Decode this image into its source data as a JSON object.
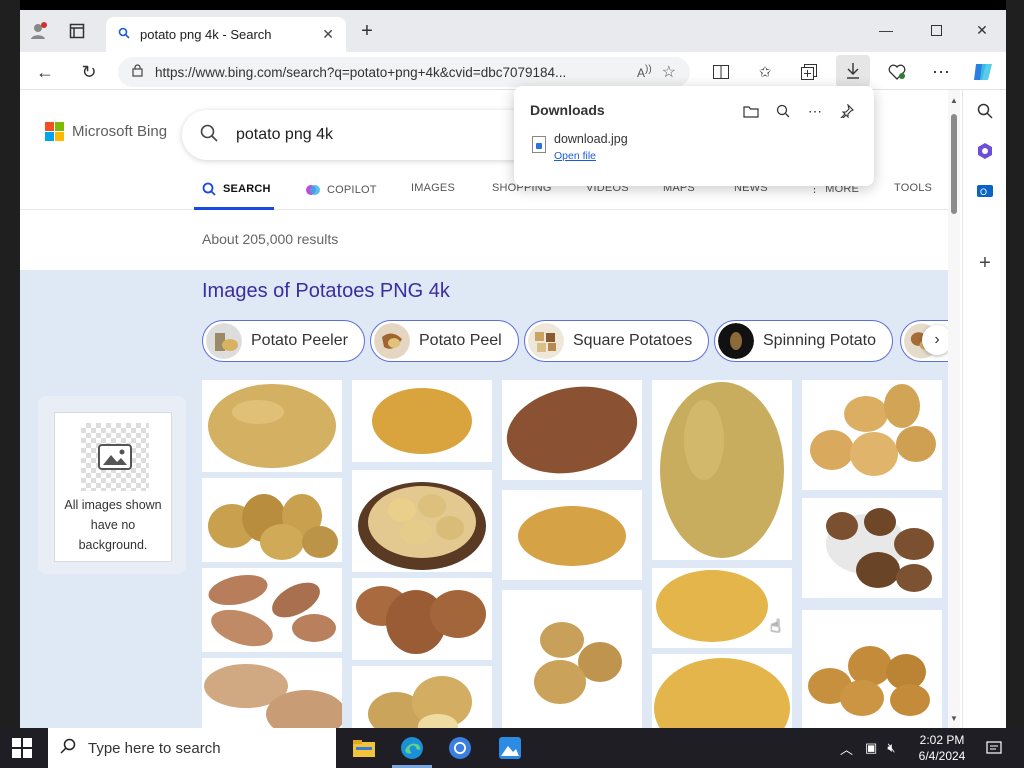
{
  "browser": {
    "tab_title": "potato png 4k - Search",
    "url": "https://www.bing.com/search?q=potato+png+4k&cvid=dbc7079184..."
  },
  "page": {
    "logo_text": "Microsoft Bing",
    "search_query": "potato png 4k",
    "scopes": [
      "SEARCH",
      "COPILOT",
      "IMAGES",
      "SHOPPING",
      "VIDEOS",
      "MAPS",
      "NEWS",
      "MORE",
      "TOOLS"
    ],
    "active_scope": "SEARCH",
    "results_count": "About 205,000 results",
    "images_title": "Images of Potatoes PNG 4k",
    "chips": [
      "Potato Peeler",
      "Potato Peel",
      "Square Potatoes",
      "Spinning Potato"
    ],
    "no_background_note": "All images shown have no background."
  },
  "downloads": {
    "title": "Downloads",
    "file_name": "download.jpg",
    "open_label": "Open file"
  },
  "taskbar": {
    "search_placeholder": "Type here to search",
    "time": "2:02 PM",
    "date": "6/4/2024"
  },
  "colors": {
    "accent": "#174ae4",
    "images_title": "#3a2da0",
    "images_bg": "#dfe8f5",
    "potato_yellow": "#d9b35a",
    "potato_brown": "#8a5232"
  }
}
